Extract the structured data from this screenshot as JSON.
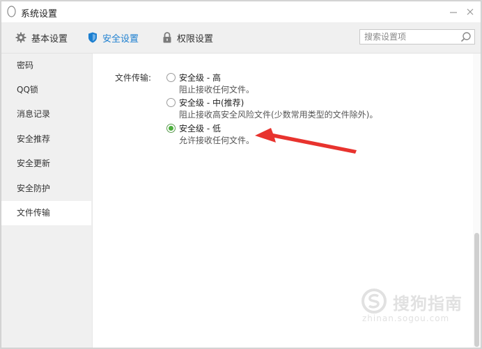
{
  "window": {
    "title": "系统设置"
  },
  "toolbar": {
    "tabs": [
      {
        "label": "基本设置",
        "icon": "gear-icon"
      },
      {
        "label": "安全设置",
        "icon": "shield-icon",
        "active": true
      },
      {
        "label": "权限设置",
        "icon": "lock-icon"
      }
    ],
    "search_placeholder": "搜索设置项"
  },
  "sidebar": {
    "items": [
      {
        "label": "密码"
      },
      {
        "label": "QQ锁"
      },
      {
        "label": "消息记录"
      },
      {
        "label": "安全推荐"
      },
      {
        "label": "安全更新"
      },
      {
        "label": "安全防护"
      },
      {
        "label": "文件传输",
        "active": true
      }
    ]
  },
  "content": {
    "field_label": "文件传输:",
    "options": [
      {
        "title": "安全级 - 高",
        "desc": "阻止接收任何文件。",
        "checked": false
      },
      {
        "title": "安全级 - 中(推荐)",
        "desc": "阻止接收高安全风险文件(少数常用类型的文件除外)。",
        "checked": false
      },
      {
        "title": "安全级 - 低",
        "desc": "允许接收任何文件。",
        "checked": true
      }
    ]
  },
  "watermark": {
    "text": "搜狗指南",
    "url": "zhinan.sogou.com"
  },
  "colors": {
    "accent": "#1c7fd0",
    "radio_checked": "#4caf3c",
    "arrow": "#e8332e"
  }
}
